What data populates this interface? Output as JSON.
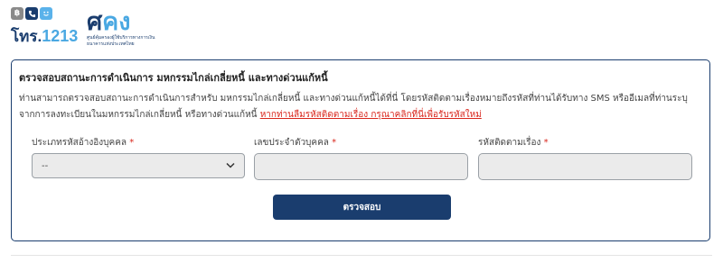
{
  "logo": {
    "phone_number_prefix": "โทร.",
    "phone_number": "1213",
    "brand_part1": "ศ",
    "brand_part2": "คง",
    "subtitle_line1": "ศูนย์คุ้มครองผู้ใช้บริการทางการเงิน",
    "subtitle_line2": "ธนาคารแห่งประเทศไทย",
    "icon_b": "฿"
  },
  "form": {
    "title": "ตรวจสอบสถานะการดำเนินการ มหกรรมไกล่เกลี่ยหนี้ และทางด่วนแก้หนี้",
    "description": "ท่านสามารถตรวจสอบสถานะการดำเนินการสำหรับ มหกรรมไกล่เกลี่ยหนี้ และทางด่วนแก้หนี้ได้ที่นี่ โดยรหัสติดตามเรื่องหมายถึงรหัสที่ท่านได้รับทาง SMS หรืออีเมลที่ท่านระบุจากการลงทะเบียนในมหกรรมไกล่เกลี่ยหนี้ หรือทางด่วนแก้หนี้ ",
    "description_link": "หากท่านลืมรหัสติดตามเรื่อง กรุณาคลิกที่นี่เพื่อรับรหัสใหม่",
    "label_reference_type": "ประเภทรหัสอ้างอิงบุคคล",
    "label_id_number": "เลขประจำตัวบุคคล",
    "label_tracking_code": "รหัสติดตามเรื่อง",
    "required_mark": "*",
    "select_value": "--",
    "submit_label": "ตรวจสอบ"
  },
  "colors": {
    "primary": "#1a3d6e",
    "accent": "#4aa8e2",
    "link_red": "#d9261c"
  }
}
